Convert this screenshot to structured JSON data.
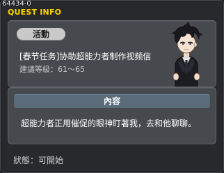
{
  "window": {
    "quest_id": "64434-0",
    "title": "QUEST INFO",
    "title_color": "#ffd400"
  },
  "summary": {
    "tag_label": "活動",
    "quest_name": "[春节任务]协助超能力者制作视频信",
    "level_label": "建議等級：",
    "level_range": "61～65",
    "npc_icon": "npc-character-portrait"
  },
  "content": {
    "header": "內容",
    "text": "超能力者正用催促的眼神盯著我，去和他聊聊。"
  },
  "status": {
    "label": "狀態：",
    "value": "可開始"
  }
}
